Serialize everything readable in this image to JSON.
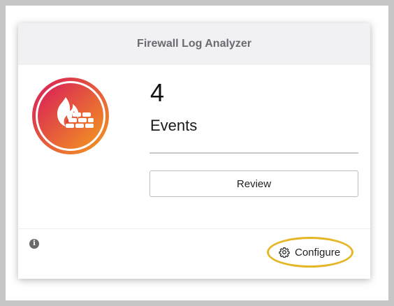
{
  "card": {
    "title": "Firewall Log Analyzer",
    "count": "4",
    "count_label": "Events",
    "review_label": "Review",
    "configure_label": "Configure"
  },
  "icons": {
    "logo": "firewall-flame-icon",
    "info": "info-icon",
    "configure": "gear-icon"
  },
  "colors": {
    "logo_gradient_start": "#d81b5a",
    "logo_gradient_end": "#f39a1e",
    "highlight": "#e5b727"
  }
}
